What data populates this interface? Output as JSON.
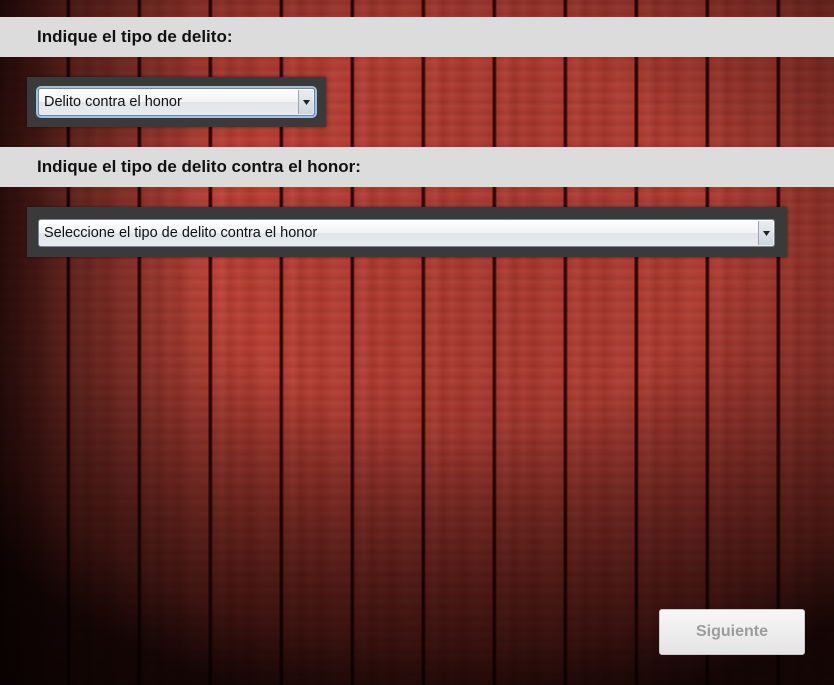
{
  "section1": {
    "label": "Indique el tipo de delito:",
    "select_value": "Delito contra el honor"
  },
  "section2": {
    "label": "Indique el tipo de delito contra el honor:",
    "select_value": "Seleccione el tipo de delito contra el honor"
  },
  "footer": {
    "next_label": "Siguiente"
  },
  "icons": {
    "dropdown": "chevron-down-icon"
  },
  "colors": {
    "label_bar": "#dcdcdc",
    "wood": "#b63b2f",
    "focus_ring": "#9cc1e8",
    "disabled_text": "#9c9c9c"
  }
}
